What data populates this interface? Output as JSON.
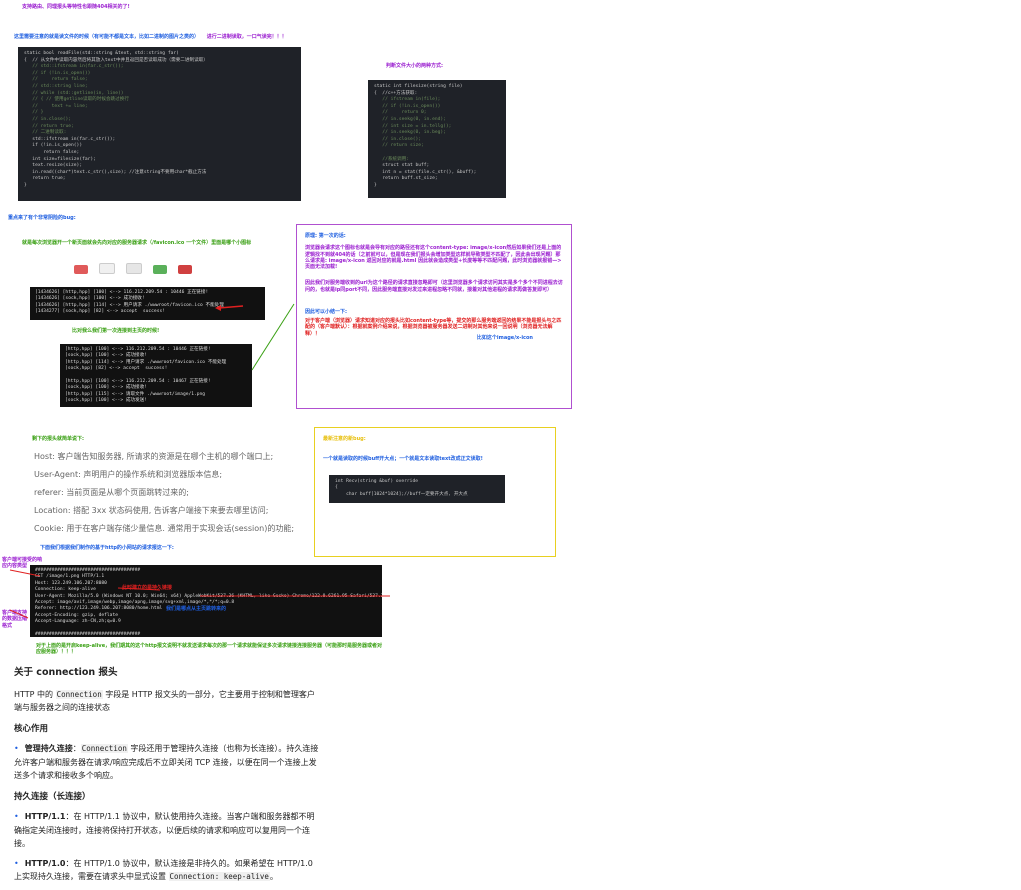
{
  "top": {
    "line1": "支持路由、同理报头等特性也跟随404相关的了!"
  },
  "notes": {
    "read_file_heading": "这里需要注意的就是读文件的时候（有可能不都是文本，比如二进制的图片之类的）",
    "read_file_tip": "进行二进制读取，一口气读完！！！",
    "file_size_heading": "判断文件大小的两种方式:",
    "bug_heading": "重点来了有个非常阴险的bug:",
    "favicon_heading": "就是每次浏览器开一个新页面就会先向对应的服务器请求（/favicon.ico 一个文件）里面是哪个小图标",
    "first_request_caption": "比对我么我们第一次连接到主页的时候!",
    "cause_title": "原理: 第一次的话:",
    "cause_body": "浏览器会请求这个图标也就是会导有对应的路径还有这个content-type: image/x-icon然后如果我们还是上面的逻辑找不到就404的话（之前就可以，但是现在我们报头会增加类型这样就导致类型不匹配了，因此会出现问题）那么请求是: image/x-icon 返回对应的就是.html 因此就会造成类型+长度等等不匹配问题，此时浏览器就报错—>页面无法加载!",
    "cause_fix": "因此我们对服务端收到的url为这个路径的请求直接忽略即可（这里浏览器多个请求访问其实是多个多个不同进程去访问的，也就是ip同port不同，因此服务端直接对发过来进程忽略不同就，接着对其他进程的请求再做答复即可）",
    "summary_title": "因此可以小结一下:",
    "summary_body": "对于客户端（浏览器）请求知道对应的报头比如content-type等，提交的那么服务端返回的结果不能是报头与之匹配的（客户端默认）：根据就案例介绍来说，根据浏览器被服务器发送二进制对其他来说一回说明（浏览器无法解释）！",
    "summary_tag": "比如这个image/x-icon",
    "other_bug_title": "最新注意的新bug:",
    "other_bug_body": "一个就是读取的时候buff开大点；一个就是文本读取text改成正文读取!",
    "headers_intro": "剩下的报头就简单说下:",
    "http_request_intro": "下面我们根据我们制作的基于http的小网站的请求报这一下:",
    "keepalive_note": "对于上面的是开启keep-alive，我们期其的这个http报文说明不就发送请求每次的那一个请求就能保证多次请求链接连接服务器（可能那时是服务器或者对应服务器）！！！",
    "client_side_label": "客户端可接受的响应内容类型",
    "client_side_label2": "客户端支持的数据压缩格式",
    "persistent_label": "此时建立的是持久链接",
    "referer_label": "我们是哪点从主页跳转来的"
  },
  "header_list": [
    "Host: 客户端告知服务器, 所请求的资源是在哪个主机的哪个端口上;",
    "User-Agent: 声明用户的操作系统和浏览器版本信息;",
    "referer: 当前页面是从哪个页面跳转过来的;",
    "Location: 搭配 3xx 状态码使用, 告诉客户端接下来要去哪里访问;",
    "Cookie: 用于在客户端存储少量信息. 通常用于实现会话(session)的功能;"
  ],
  "code_readfile": [
    "static bool readFile(std::string &text, std::string far)",
    "{  // 从文件中读取内容然后将其放入text中并且返回是否读取成功（需要二进制读取）",
    "   // std::ifstream in(far.c_str());",
    "   // if (!in.is_open())",
    "   //     return false;",
    "   // std::string line;",
    "   // while (std::getline(in, line))",
    "   // { // 使用getline读取的时候会跳过换行",
    "   //     text += line;",
    "   // }",
    "   // in.close();",
    "   // return true;",
    "   // 二进制读取:",
    "   std::ifstream in(far.c_str());",
    "   if (!in.is_open())",
    "       return false;",
    "   int size=filesize(far);",
    "   text.resize(size);",
    "   in.read((char*)text.c_str(),size); //注意string不要用char*截止方法",
    "   return true;",
    "}"
  ],
  "code_filesize": [
    "static int filesize(string file)",
    "{  //c++方法获取:",
    "   // ifstream in(file);",
    "   // if (!in.is_open())",
    "   //     return 0;",
    "   // in.seekg(0, in.end);",
    "   // int size = in.tellg();",
    "   // in.seekg(0, in.beg);",
    "   // in.close();",
    "   // return size;",
    "",
    "   //系统调用:",
    "   struct stat buff;",
    "   int n = stat(file.c_str(), &buff);",
    "   return buff.st_size;",
    "}"
  ],
  "code_recv": [
    "int Recv(string &buf) override",
    "{",
    "    char buff[1024*1024];//buff一定要开大点, 开大点"
  ],
  "term_favicon": [
    "[1434626] [http,hpp] [100] <--> 116.212.209.54 : 10446 正在链接!",
    "[1434626] [sock,hpp] [100] <--> 成功接收!",
    "[1434626] [http,hpp] [114] <--> 用户请求 ./wwwroot/favicon.ico 不能处理",
    "[1434277] [sock,hpp] [82] <--> accept  success!"
  ],
  "term_first": [
    "[http,hpp] [100] <--> 116.212.209.54 : 10446 正在链接!",
    "[sock,hpp] [100] <--> 成功接收!",
    "[http,hpp] [114] <--> 用户请求 ./wwwroot/favicon.ico 不能处理",
    "[sock,hpp] [82] <--> accept  success!",
    "",
    "[http,hpp] [100] <--> 116.212.209.54 : 10467 正在链接!",
    "[sock,hpp] [100] <--> 成功接收!",
    "[http,hpp] [115] <--> 请取文件 ./wwwroot/image/1.png",
    "[sock,hpp] [100] <--> 成功发送!"
  ],
  "term_request": [
    "######################################",
    "GET /image/1.png HTTP/1.1",
    "Host: 123.249.106.207:8080",
    "Connection: keep-alive",
    "User-Agent: Mozilla/5.0 (Windows NT 10.0; Win64; x64) AppleWebKit/537.36 (KHTML, like Gecko) Chrome/122.0.6261.95 Safari/537.36",
    "Accept: image/avif,image/webp,image/apng,image/svg+xml,image/*,*/*;q=0.8",
    "Referer: http://123.249.106.207:8080/home.html",
    "Accept-Encoding: gzip, deflate",
    "Accept-Language: zh-CN,zh;q=0.9",
    "",
    "######################################"
  ],
  "article": {
    "title": "关于 connection 报头",
    "intro_a": "HTTP 中的",
    "intro_code": "Connection",
    "intro_b": "字段是 HTTP 报文头的一部分，它主要用于控制和管理客户端与服务器之间的连接状态",
    "core_title": "核心作用",
    "core_bold": "管理持久连接",
    "core_code": "Connection",
    "core_text": "字段还用于管理持久连接（也称为长连接）。持久连接允许客户端和服务器在请求/响应完成后不立即关闭 TCP 连接，以便在同一个连接上发送多个请求和接收多个响应。",
    "persist_title": "持久连接（长连接）",
    "http11_bold": "HTTP/1.1",
    "http11_text": "：在 HTTP/1.1 协议中，默认使用持久连接。当客户端和服务器都不明确指定关闭连接时，连接将保持打开状态，以便后续的请求和响应可以复用同一个连接。",
    "http10_bold": "HTTP/1.0",
    "http10_text": "：在 HTTP/1.0 协议中，默认连接是非持久的。如果希望在 HTTP/1.0 上实现持久连接，需要在请求头中显式设置",
    "http10_code": "Connection: keep-alive",
    "http10_end": "。"
  },
  "colors": {
    "purple": "#9b1fd0",
    "blue": "#1f5fe0",
    "green": "#3aa014",
    "red": "#e02020",
    "yellow_box": "#e8d020"
  }
}
